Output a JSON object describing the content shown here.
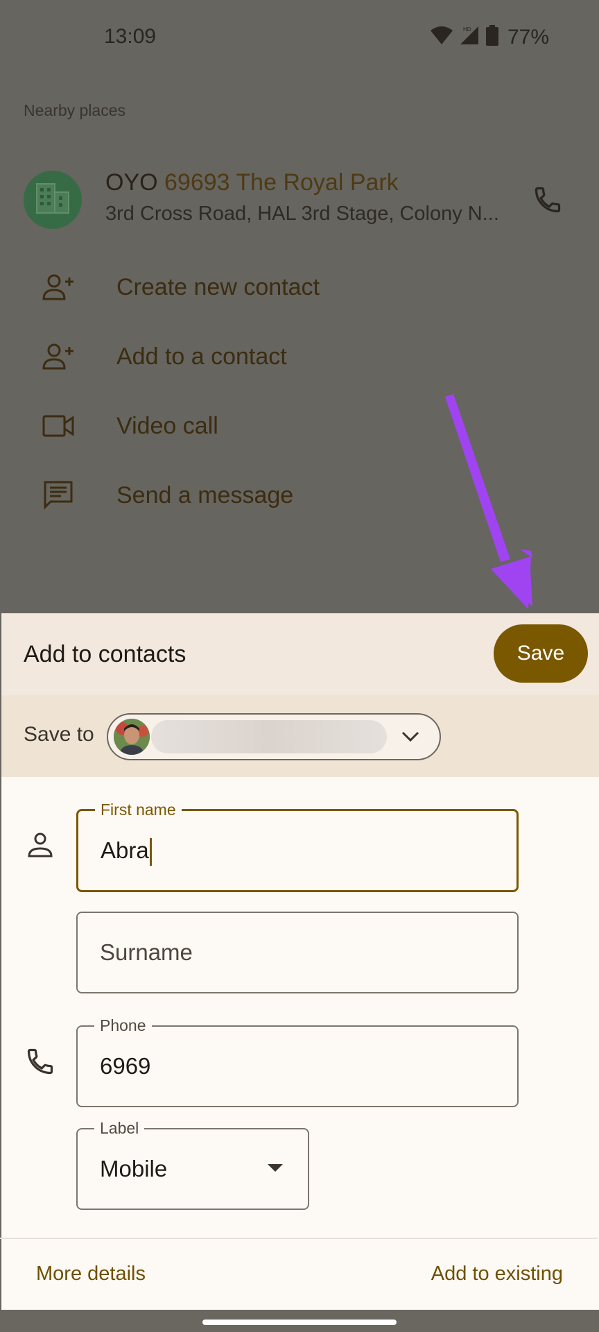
{
  "status_bar": {
    "time": "13:09",
    "battery_percent": "77%",
    "icons": [
      "wifi-icon",
      "hd-badge",
      "cellular-signal-icon",
      "battery-icon"
    ]
  },
  "background_list": {
    "section_header": "Nearby places",
    "place": {
      "name_prefix": "OYO ",
      "name_highlight": "69693 The Royal Park",
      "address": "3rd Cross Road, HAL 3rd Stage, Colony N...",
      "icon": "building-icon",
      "call_icon": "phone-icon"
    },
    "actions": [
      {
        "label": "Create new contact",
        "icon": "person-add-icon"
      },
      {
        "label": "Add to a contact",
        "icon": "person-add-icon"
      },
      {
        "label": "Video call",
        "icon": "video-camera-icon"
      },
      {
        "label": "Send a message",
        "icon": "message-icon"
      }
    ]
  },
  "annotation": {
    "color": "#a044f2",
    "description": "arrow pointing at save button"
  },
  "sheet": {
    "title": "Add to contacts",
    "save_label": "Save",
    "save_to_label": "Save to",
    "account": {
      "name_redacted": true,
      "chevron": "chevron-down-icon"
    },
    "fields": {
      "first_name": {
        "label": "First name",
        "value": "Abra",
        "focused": true
      },
      "surname": {
        "placeholder": "Surname",
        "value": ""
      },
      "phone": {
        "label": "Phone",
        "value": "6969"
      },
      "phone_label": {
        "label": "Label",
        "value": "Mobile"
      }
    },
    "footer": {
      "more_details": "More details",
      "add_to_existing": "Add to existing"
    }
  },
  "colors": {
    "scrim": "#666560",
    "accent": "#7a5800",
    "sheet_bg": "#fdf9f5",
    "header_bg": "#f2e8de",
    "saveto_bg": "#efe3d3"
  }
}
